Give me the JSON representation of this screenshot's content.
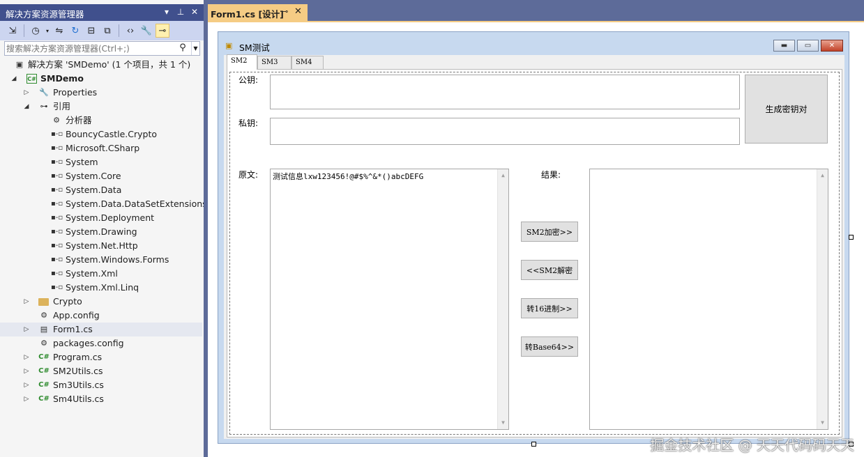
{
  "solution_explorer": {
    "title": "解决方案资源管理器",
    "title_buttons": {
      "dropdown": "▾",
      "pin": "⊥",
      "close": "✕"
    },
    "search": {
      "placeholder": "搜索解决方案资源管理器(Ctrl+;)",
      "value": ""
    },
    "tree": {
      "solution": "解决方案 'SMDemo' (1 个项目，共 1 个)",
      "project": "SMDemo",
      "properties": "Properties",
      "references": "引用",
      "analyzer": "分析器",
      "reference_items": [
        "BouncyCastle.Crypto",
        "Microsoft.CSharp",
        "System",
        "System.Core",
        "System.Data",
        "System.Data.DataSetExtensions",
        "System.Deployment",
        "System.Drawing",
        "System.Net.Http",
        "System.Windows.Forms",
        "System.Xml",
        "System.Xml.Linq"
      ],
      "crypto_folder": "Crypto",
      "files": [
        "App.config",
        "Form1.cs",
        "packages.config",
        "Program.cs",
        "SM2Utils.cs",
        "Sm3Utils.cs",
        "Sm4Utils.cs"
      ],
      "selected_file": "Form1.cs"
    }
  },
  "document_tab": {
    "title": "Form1.cs [设计]",
    "pin": "⊸",
    "close": "✕"
  },
  "form": {
    "title": "SM测试",
    "tabs": [
      "SM2",
      "SM3",
      "SM4"
    ],
    "active_tab": "SM2",
    "labels": {
      "public_key": "公钥:",
      "private_key": "私钥:",
      "plaintext": "原文:",
      "result": "结果:"
    },
    "public_key_value": "",
    "private_key_value": "",
    "plaintext_value": "测试信息lxw123456!@#$%^&*()abcDEFG",
    "result_value": "",
    "buttons": {
      "generate_keypair": "生成密钥对",
      "sm2_encrypt": "SM2加密>>",
      "sm2_decrypt": "<<SM2解密",
      "to_hex": "转16进制>>",
      "to_base64": "转Base64>>"
    }
  },
  "watermark": "掘金技术社区 @ 天天代码码天天",
  "colors": {
    "vs_chrome": "#5d6b99",
    "active_tab": "#f5cc84",
    "panel_title": "#40508d",
    "form_border": "#c7d9ef",
    "close_button": "#c2432a"
  }
}
